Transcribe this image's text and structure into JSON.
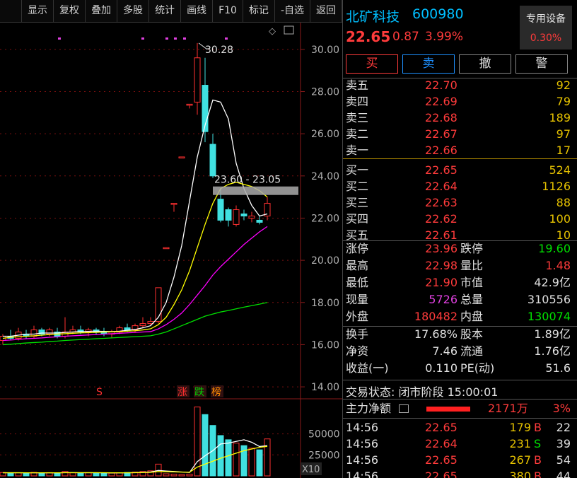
{
  "toolbar": [
    "显示",
    "复权",
    "叠加",
    "多股",
    "统计",
    "画线",
    "F10",
    "标记",
    "-自选",
    "返回"
  ],
  "stock": {
    "name": "北矿科技",
    "code": "600980",
    "price": "22.65",
    "change": "0.87",
    "change_pct": "3.99%"
  },
  "device": {
    "title": "专用设备",
    "value": "0.30%"
  },
  "trade_buttons": [
    "买",
    "卖",
    "撤",
    "警"
  ],
  "sell_orders": [
    {
      "label": "卖五",
      "price": "22.70",
      "vol": "92"
    },
    {
      "label": "卖四",
      "price": "22.69",
      "vol": "79"
    },
    {
      "label": "卖三",
      "price": "22.68",
      "vol": "189"
    },
    {
      "label": "卖二",
      "price": "22.67",
      "vol": "97"
    },
    {
      "label": "卖一",
      "price": "22.66",
      "vol": "17"
    }
  ],
  "buy_orders": [
    {
      "label": "买一",
      "price": "22.65",
      "vol": "524"
    },
    {
      "label": "买二",
      "price": "22.64",
      "vol": "1126"
    },
    {
      "label": "买三",
      "price": "22.63",
      "vol": "88"
    },
    {
      "label": "买四",
      "price": "22.62",
      "vol": "100"
    },
    {
      "label": "买五",
      "price": "22.61",
      "vol": "10"
    }
  ],
  "stats1": [
    {
      "l": "涨停",
      "lv": "23.96",
      "lc": "#ff3b3b",
      "r": "跌停",
      "rv": "19.60",
      "rc": "#00e000"
    },
    {
      "l": "最高",
      "lv": "22.98",
      "lc": "#ff3b3b",
      "r": "量比",
      "rv": "1.48",
      "rc": "#ff3b3b"
    },
    {
      "l": "最低",
      "lv": "21.90",
      "lc": "#ff3b3b",
      "r": "市值",
      "rv": "42.9亿",
      "rc": "#e0e0e0"
    },
    {
      "l": "现量",
      "lv": "5726",
      "lc": "#e040e0",
      "r": "总量",
      "rv": "310556",
      "rc": "#e0e0e0"
    },
    {
      "l": "外盘",
      "lv": "180482",
      "lc": "#ff3b3b",
      "r": "内盘",
      "rv": "130074",
      "rc": "#00e000"
    }
  ],
  "stats2": [
    {
      "l": "换手",
      "lv": "17.68%",
      "lc": "#e0e0e0",
      "r": "股本",
      "rv": "1.89亿",
      "rc": "#e0e0e0"
    },
    {
      "l": "净资",
      "lv": "7.46",
      "lc": "#e0e0e0",
      "r": "流通",
      "rv": "1.76亿",
      "rc": "#e0e0e0"
    },
    {
      "l": "收益(一)",
      "lv": "0.110",
      "lc": "#e0e0e0",
      "r": "PE(动)",
      "rv": "51.6",
      "rc": "#e0e0e0"
    }
  ],
  "status": "交易状态: 闭市阶段 15:00:01",
  "flow": {
    "label": "主力净额",
    "value": "2171万",
    "pct": "3%"
  },
  "ticks": [
    {
      "time": "14:56",
      "price": "22.65",
      "vol": "179",
      "side": "B",
      "cnt": "22"
    },
    {
      "time": "14:56",
      "price": "22.64",
      "vol": "231",
      "side": "S",
      "cnt": "39"
    },
    {
      "time": "14:56",
      "price": "22.65",
      "vol": "267",
      "side": "B",
      "cnt": "54"
    },
    {
      "time": "14:56",
      "price": "22.65",
      "vol": "380",
      "side": "B",
      "cnt": "44"
    }
  ],
  "chart_data": {
    "type": "candlestick",
    "y_ticks": [
      "30.00",
      "28.00",
      "26.00",
      "24.00",
      "22.00",
      "20.00",
      "18.00",
      "16.00",
      "14.00"
    ],
    "ylim": [
      13.5,
      31.0
    ],
    "max_label": "30.28",
    "range_label": "23.60 - 23.05",
    "markers": [
      "S",
      "涨",
      "跌",
      "榜"
    ],
    "candles": [
      {
        "o": 16.2,
        "h": 16.5,
        "l": 16.0,
        "c": 16.4
      },
      {
        "o": 16.4,
        "h": 16.7,
        "l": 16.2,
        "c": 16.3
      },
      {
        "o": 16.3,
        "h": 16.8,
        "l": 16.2,
        "c": 16.6
      },
      {
        "o": 16.5,
        "h": 16.7,
        "l": 16.3,
        "c": 16.4
      },
      {
        "o": 16.4,
        "h": 16.9,
        "l": 16.3,
        "c": 16.7
      },
      {
        "o": 16.7,
        "h": 16.8,
        "l": 16.4,
        "c": 16.5
      },
      {
        "o": 16.5,
        "h": 16.8,
        "l": 16.4,
        "c": 16.7
      },
      {
        "o": 16.6,
        "h": 16.8,
        "l": 16.3,
        "c": 16.4
      },
      {
        "o": 16.4,
        "h": 17.3,
        "l": 16.3,
        "c": 16.6
      },
      {
        "o": 16.6,
        "h": 16.9,
        "l": 16.5,
        "c": 16.7
      },
      {
        "o": 16.7,
        "h": 16.9,
        "l": 16.5,
        "c": 16.6
      },
      {
        "o": 16.6,
        "h": 16.8,
        "l": 16.4,
        "c": 16.7
      },
      {
        "o": 16.7,
        "h": 16.8,
        "l": 16.5,
        "c": 16.6
      },
      {
        "o": 16.6,
        "h": 16.8,
        "l": 16.4,
        "c": 16.5
      },
      {
        "o": 16.5,
        "h": 16.7,
        "l": 16.3,
        "c": 16.6
      },
      {
        "o": 16.6,
        "h": 16.9,
        "l": 16.5,
        "c": 16.8
      },
      {
        "o": 16.8,
        "h": 17.0,
        "l": 16.6,
        "c": 16.7
      },
      {
        "o": 16.7,
        "h": 17.0,
        "l": 16.6,
        "c": 16.9
      },
      {
        "o": 16.9,
        "h": 17.3,
        "l": 16.8,
        "c": 17.0
      },
      {
        "o": 17.0,
        "h": 17.3,
        "l": 16.9,
        "c": 17.1
      },
      {
        "o": 17.1,
        "h": 18.7,
        "l": 17.0,
        "c": 18.7
      },
      {
        "o": 20.6,
        "h": 20.6,
        "l": 20.6,
        "c": 20.6
      },
      {
        "o": 22.7,
        "h": 22.7,
        "l": 22.3,
        "c": 22.7
      },
      {
        "o": 24.9,
        "h": 24.9,
        "l": 24.9,
        "c": 24.9
      },
      {
        "o": 27.4,
        "h": 27.4,
        "l": 27.2,
        "c": 27.4
      },
      {
        "o": 27.5,
        "h": 30.3,
        "l": 26.9,
        "c": 29.6
      },
      {
        "o": 28.3,
        "h": 29.6,
        "l": 25.6,
        "c": 26.1
      },
      {
        "o": 25.5,
        "h": 26.0,
        "l": 23.9,
        "c": 24.0
      },
      {
        "o": 22.9,
        "h": 23.4,
        "l": 21.8,
        "c": 21.9
      },
      {
        "o": 22.4,
        "h": 22.5,
        "l": 21.6,
        "c": 21.9
      },
      {
        "o": 21.7,
        "h": 22.6,
        "l": 21.6,
        "c": 22.4
      },
      {
        "o": 22.2,
        "h": 22.4,
        "l": 21.9,
        "c": 22.1
      },
      {
        "o": 22.0,
        "h": 22.3,
        "l": 21.8,
        "c": 22.1
      },
      {
        "o": 21.9,
        "h": 22.1,
        "l": 21.7,
        "c": 21.8
      },
      {
        "o": 22.1,
        "h": 23.0,
        "l": 21.9,
        "c": 22.7
      }
    ],
    "ma5": [
      16.4,
      16.4,
      16.45,
      16.5,
      16.5,
      16.55,
      16.55,
      16.55,
      16.58,
      16.6,
      16.62,
      16.63,
      16.64,
      16.63,
      16.62,
      16.64,
      16.68,
      16.72,
      16.8,
      16.9,
      17.3,
      18.0,
      19.2,
      20.7,
      22.8,
      24.9,
      26.4,
      27.6,
      27.5,
      26.7,
      24.6,
      23.4,
      22.6,
      22.1,
      22.2
    ],
    "ma10": [
      16.3,
      16.35,
      16.38,
      16.4,
      16.42,
      16.45,
      16.48,
      16.5,
      16.52,
      16.54,
      16.56,
      16.57,
      16.58,
      16.6,
      16.61,
      16.62,
      16.64,
      16.66,
      16.7,
      16.75,
      16.95,
      17.3,
      17.9,
      18.6,
      19.5,
      20.6,
      21.7,
      22.7,
      23.4,
      23.6,
      23.7,
      23.6,
      23.5,
      23.3,
      23.0
    ],
    "ma20": [
      16.2,
      16.22,
      16.25,
      16.28,
      16.3,
      16.32,
      16.35,
      16.37,
      16.4,
      16.42,
      16.44,
      16.46,
      16.48,
      16.5,
      16.52,
      16.54,
      16.56,
      16.58,
      16.6,
      16.62,
      16.75,
      16.95,
      17.2,
      17.5,
      17.9,
      18.35,
      18.8,
      19.3,
      19.7,
      20.05,
      20.4,
      20.75,
      21.05,
      21.35,
      21.6
    ],
    "ma60": [
      16.0,
      16.02,
      16.05,
      16.08,
      16.1,
      16.12,
      16.15,
      16.17,
      16.2,
      16.22,
      16.24,
      16.26,
      16.28,
      16.3,
      16.32,
      16.34,
      16.36,
      16.38,
      16.4,
      16.42,
      16.5,
      16.6,
      16.75,
      16.9,
      17.05,
      17.2,
      17.35,
      17.45,
      17.55,
      17.62,
      17.7,
      17.78,
      17.85,
      17.92,
      18.0
    ],
    "volume_ticks": [
      "50000",
      "25000"
    ],
    "volume_unit": "X10",
    "volume_ylim": [
      0,
      85000
    ],
    "volumes": [
      4000,
      3500,
      3800,
      3000,
      4200,
      3600,
      3900,
      3300,
      5200,
      3700,
      3500,
      3900,
      3400,
      3600,
      3300,
      3800,
      4100,
      4500,
      5200,
      6000,
      14000,
      2500,
      2000,
      1500,
      2000,
      82000,
      73000,
      60000,
      48000,
      43000,
      39000,
      36000,
      33000,
      31000,
      44000
    ],
    "vol_ma1": [
      3800,
      3800,
      3800,
      3700,
      3700,
      3700,
      3700,
      3600,
      3900,
      3900,
      3800,
      3800,
      3800,
      3700,
      3600,
      3600,
      3700,
      3900,
      4200,
      4600,
      6500,
      5800,
      5200,
      4600,
      4000,
      17000,
      24000,
      30000,
      38000,
      39000,
      41000,
      43000,
      40000,
      35000,
      36000
    ],
    "vol_ma2": [
      3700,
      3700,
      3700,
      3700,
      3700,
      3700,
      3700,
      3700,
      3800,
      3800,
      3800,
      3800,
      3800,
      3800,
      3700,
      3700,
      3700,
      3800,
      4000,
      4200,
      5200,
      5000,
      4800,
      4500,
      4300,
      10500,
      14000,
      17500,
      21000,
      24000,
      27000,
      30000,
      32000,
      34000,
      35000
    ]
  }
}
